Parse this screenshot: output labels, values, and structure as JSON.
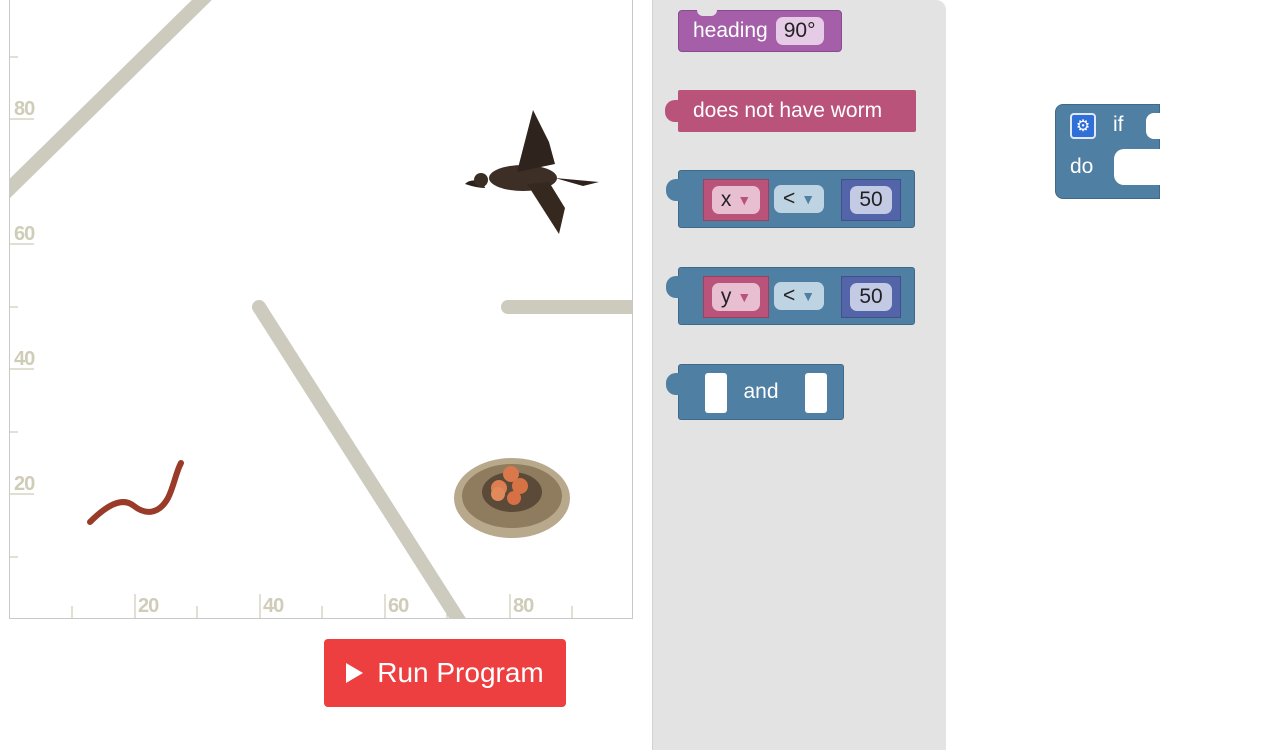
{
  "stage": {
    "y_tick_labels": [
      "80",
      "60",
      "40",
      "20"
    ],
    "x_tick_labels": [
      "20",
      "40",
      "60",
      "80"
    ],
    "sprites": {
      "bird": "bird-sprite",
      "worm": "worm-sprite",
      "nest": "nest-sprite"
    }
  },
  "run_button": {
    "label": "Run Program",
    "icon": "play-icon",
    "color": "#ed3f3f"
  },
  "toolbox": {
    "heading_block": {
      "label": "heading",
      "value": "90°",
      "color": "#a45fa8"
    },
    "worm_block": {
      "label": "does not have worm",
      "color": "#b9537a"
    },
    "compare_x": {
      "variable": "x",
      "operator": "<",
      "value": "50"
    },
    "compare_y": {
      "variable": "y",
      "operator": "<",
      "value": "50"
    },
    "and_block": {
      "label": "and"
    }
  },
  "workspace": {
    "if_block": {
      "if_label": "if",
      "do_label": "do",
      "color": "#4f7fa3"
    }
  }
}
